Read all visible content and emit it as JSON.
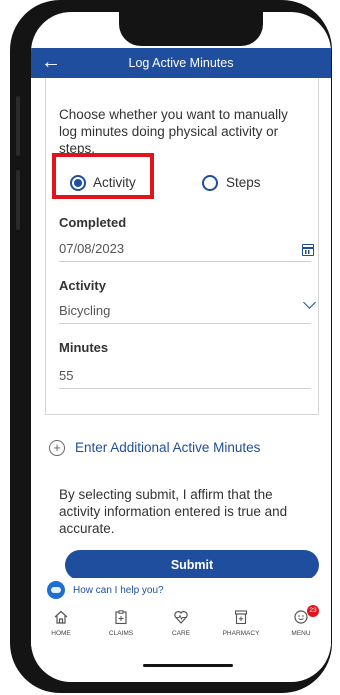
{
  "header": {
    "back_glyph": "←",
    "title": "Log Active Minutes"
  },
  "intro": "Choose whether you want to manually log minutes doing physical activity or steps.",
  "radio": {
    "activity_label": "Activity",
    "steps_label": "Steps",
    "selected": "Activity"
  },
  "fields": {
    "completed": {
      "label": "Completed",
      "value": "07/08/2023"
    },
    "activity": {
      "label": "Activity",
      "value": "Bicycling"
    },
    "minutes": {
      "label": "Minutes",
      "value": "55"
    }
  },
  "add_more": {
    "plus_glyph": "+",
    "label": "Enter Additional Active Minutes"
  },
  "affirm": "By selecting submit, I affirm that the activity information entered is true and accurate.",
  "submit_label": "Submit",
  "help": {
    "label": "How can I help you?"
  },
  "nav": {
    "home": "HOME",
    "claims": "CLAIMS",
    "care": "CARE",
    "pharmacy": "PHARMACY",
    "menu": "MENU",
    "menu_badge": "23"
  },
  "colors": {
    "primary": "#1f4e9f",
    "highlight": "#e0141d"
  }
}
